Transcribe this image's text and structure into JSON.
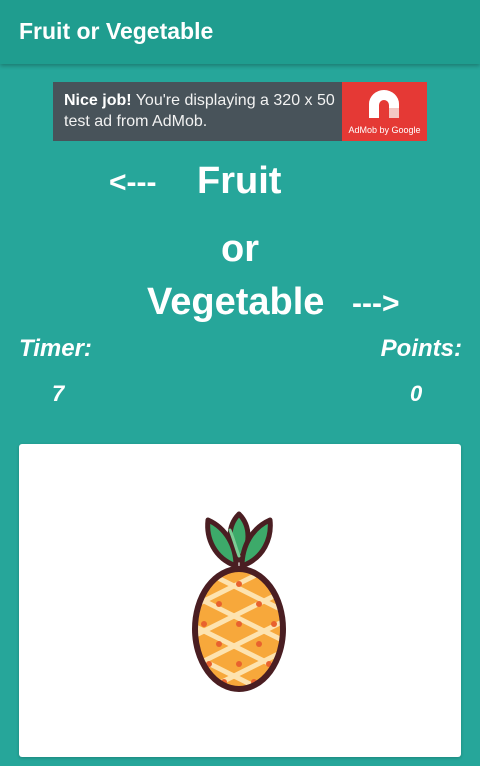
{
  "app_bar": {
    "title": "Fruit or Vegetable"
  },
  "ad": {
    "headline": "Nice job!",
    "body": " You're displaying a 320 x 50 test ad from AdMob.",
    "brand_caption": "AdMob by Google",
    "brand_color": "#E53935",
    "icon": "admob-logo-icon"
  },
  "prompt": {
    "left_arrow": "<---",
    "fruit": "Fruit",
    "or": "or",
    "vegetable": "Vegetable",
    "right_arrow": "--->"
  },
  "stats": {
    "timer_label": "Timer:",
    "timer_value": "7",
    "points_label": "Points:",
    "points_value": "0"
  },
  "card": {
    "image": "pineapple-icon"
  },
  "colors": {
    "background": "#26A69A",
    "app_bar": "#1F9D8F",
    "card": "#FFFFFF"
  }
}
